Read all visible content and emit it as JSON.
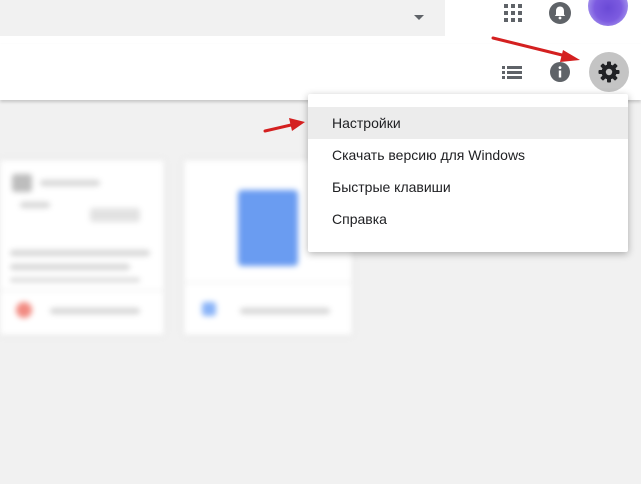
{
  "topbar": {
    "search_dropdown_icon": "caret-down-icon",
    "apps_icon": "apps-grid-icon",
    "notifications_icon": "bell-icon",
    "avatar_color": "#6a4ad6"
  },
  "toolbar": {
    "list_view_icon": "list-view-icon",
    "info_icon": "info-icon",
    "settings_icon": "gear-icon"
  },
  "settings_menu": {
    "items": [
      {
        "label": "Настройки",
        "highlighted": true
      },
      {
        "label": "Скачать версию для Windows",
        "highlighted": false
      },
      {
        "label": "Быстрые клавиши",
        "highlighted": false
      },
      {
        "label": "Справка",
        "highlighted": false
      }
    ]
  },
  "annotations": {
    "arrow_color": "#d42020"
  }
}
